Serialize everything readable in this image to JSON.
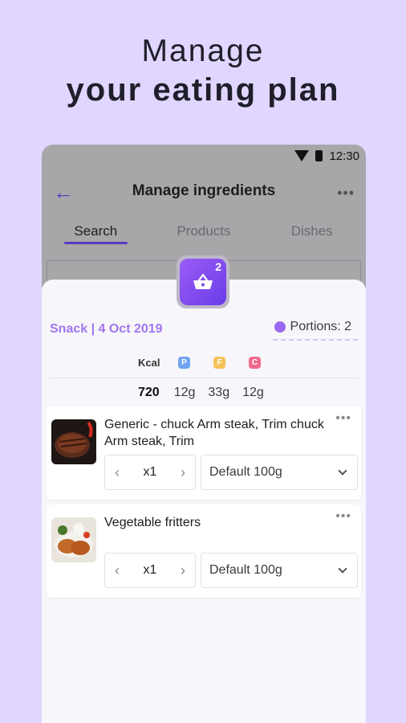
{
  "headline": {
    "line1": "Manage",
    "line2": "your eating plan"
  },
  "status": {
    "time": "12:30"
  },
  "appbar": {
    "title": "Manage ingredients"
  },
  "tabs": [
    {
      "label": "Search"
    },
    {
      "label": "Products"
    },
    {
      "label": "Dishes"
    }
  ],
  "basket": {
    "count": "2"
  },
  "meal": {
    "label": "Snack | 4 Oct 2019",
    "portions": "Portions: 2"
  },
  "macros": {
    "headers": {
      "kcal": "Kcal",
      "p": "P",
      "f": "F",
      "c": "C"
    },
    "values": {
      "kcal": "720",
      "p": "12g",
      "f": "33g",
      "c": "12g"
    }
  },
  "items": [
    {
      "name": "Generic - chuck Arm steak, Trim chuck Arm steak, Trim",
      "qty": "x1",
      "portion": "Default 100g"
    },
    {
      "name": "Vegetable fritters",
      "qty": "x1",
      "portion": "Default 100g"
    }
  ],
  "colors": {
    "accent": "#6a3de8",
    "meal": "#a176f0",
    "p": "#6fa3f0",
    "f": "#f5c25a",
    "c": "#f06a8e"
  }
}
